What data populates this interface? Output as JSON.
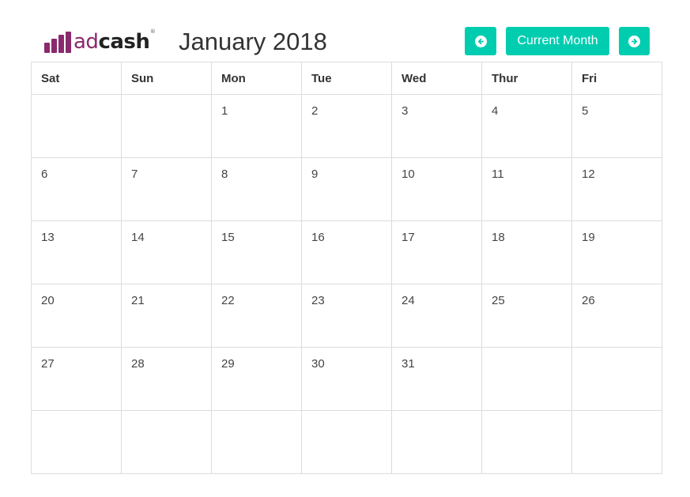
{
  "logo": {
    "text_ad": "ad",
    "text_cash": "cash",
    "reg_mark": "®",
    "colors": {
      "bars": "#8a2a6d",
      "ad": "#8a2a6d",
      "cash": "#222222"
    }
  },
  "header": {
    "title": "January 2018"
  },
  "nav": {
    "prev_icon": "arrow-left-circle-icon",
    "current_label": "Current Month",
    "next_icon": "arrow-right-circle-icon",
    "accent_color": "#00cdb0"
  },
  "calendar": {
    "weekdays": [
      "Sat",
      "Sun",
      "Mon",
      "Tue",
      "Wed",
      "Thur",
      "Fri"
    ],
    "weeks": [
      [
        "",
        "",
        "1",
        "2",
        "3",
        "4",
        "5"
      ],
      [
        "6",
        "7",
        "8",
        "9",
        "10",
        "11",
        "12"
      ],
      [
        "13",
        "14",
        "15",
        "16",
        "17",
        "18",
        "19"
      ],
      [
        "20",
        "21",
        "22",
        "23",
        "24",
        "25",
        "26"
      ],
      [
        "27",
        "28",
        "29",
        "30",
        "31",
        "",
        ""
      ],
      [
        "",
        "",
        "",
        "",
        "",
        "",
        ""
      ]
    ]
  }
}
